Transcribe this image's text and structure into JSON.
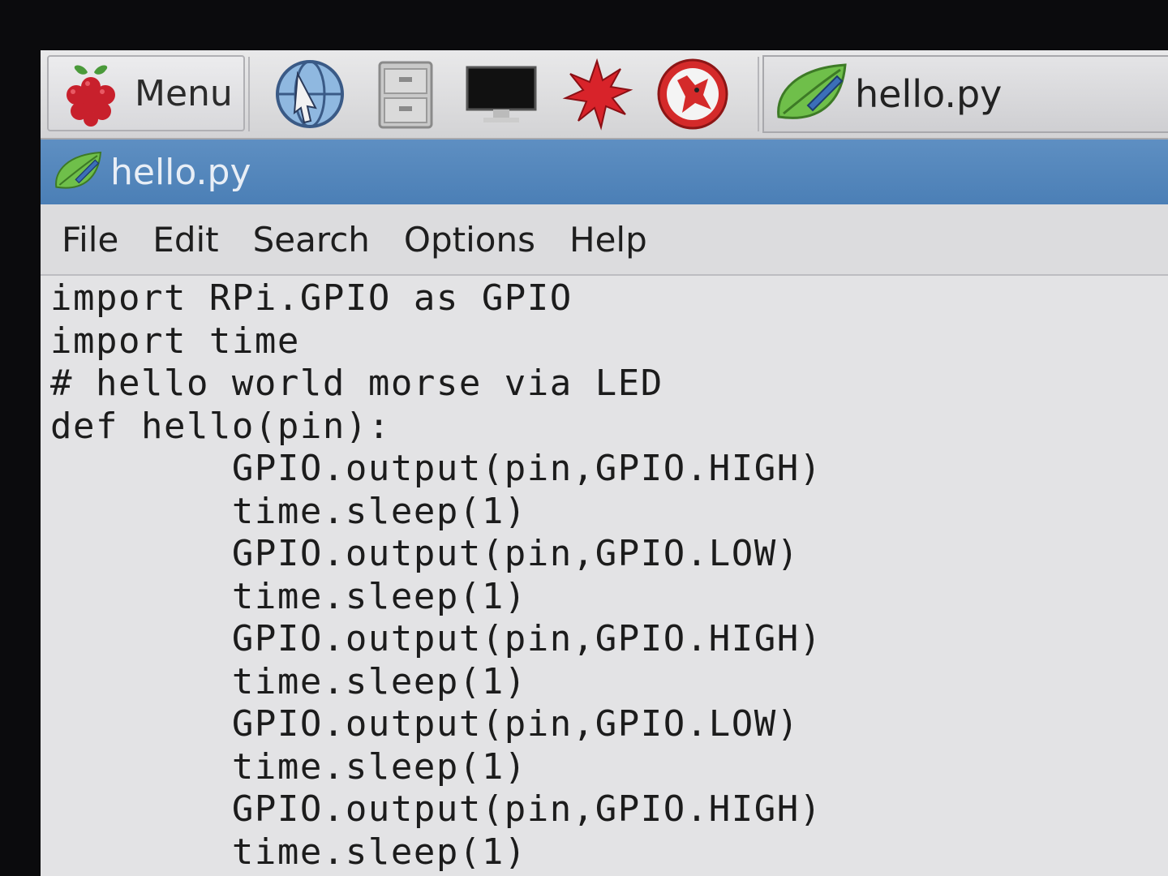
{
  "taskbar": {
    "menu_label": "Menu",
    "launchers": [
      {
        "icon": "web-browser-icon"
      },
      {
        "icon": "file-manager-icon"
      },
      {
        "icon": "terminal-icon"
      },
      {
        "icon": "mathematica-icon"
      },
      {
        "icon": "wolfram-icon"
      }
    ],
    "task_label": "hello.py"
  },
  "window": {
    "title": "hello.py"
  },
  "menubar": {
    "items": [
      "File",
      "Edit",
      "Search",
      "Options",
      "Help"
    ]
  },
  "editor": {
    "lines": [
      "import RPi.GPIO as GPIO",
      "import time",
      "# hello world morse via LED",
      "def hello(pin):",
      "        GPIO.output(pin,GPIO.HIGH)",
      "        time.sleep(1)",
      "        GPIO.output(pin,GPIO.LOW)",
      "        time.sleep(1)",
      "        GPIO.output(pin,GPIO.HIGH)",
      "        time.sleep(1)",
      "        GPIO.output(pin,GPIO.LOW)",
      "        time.sleep(1)",
      "        GPIO.output(pin,GPIO.HIGH)",
      "        time.sleep(1)"
    ]
  },
  "colors": {
    "titlebar": "#4b7fb6",
    "editor_bg": "#e3e3e5",
    "leaf_green": "#6fbf4a"
  }
}
